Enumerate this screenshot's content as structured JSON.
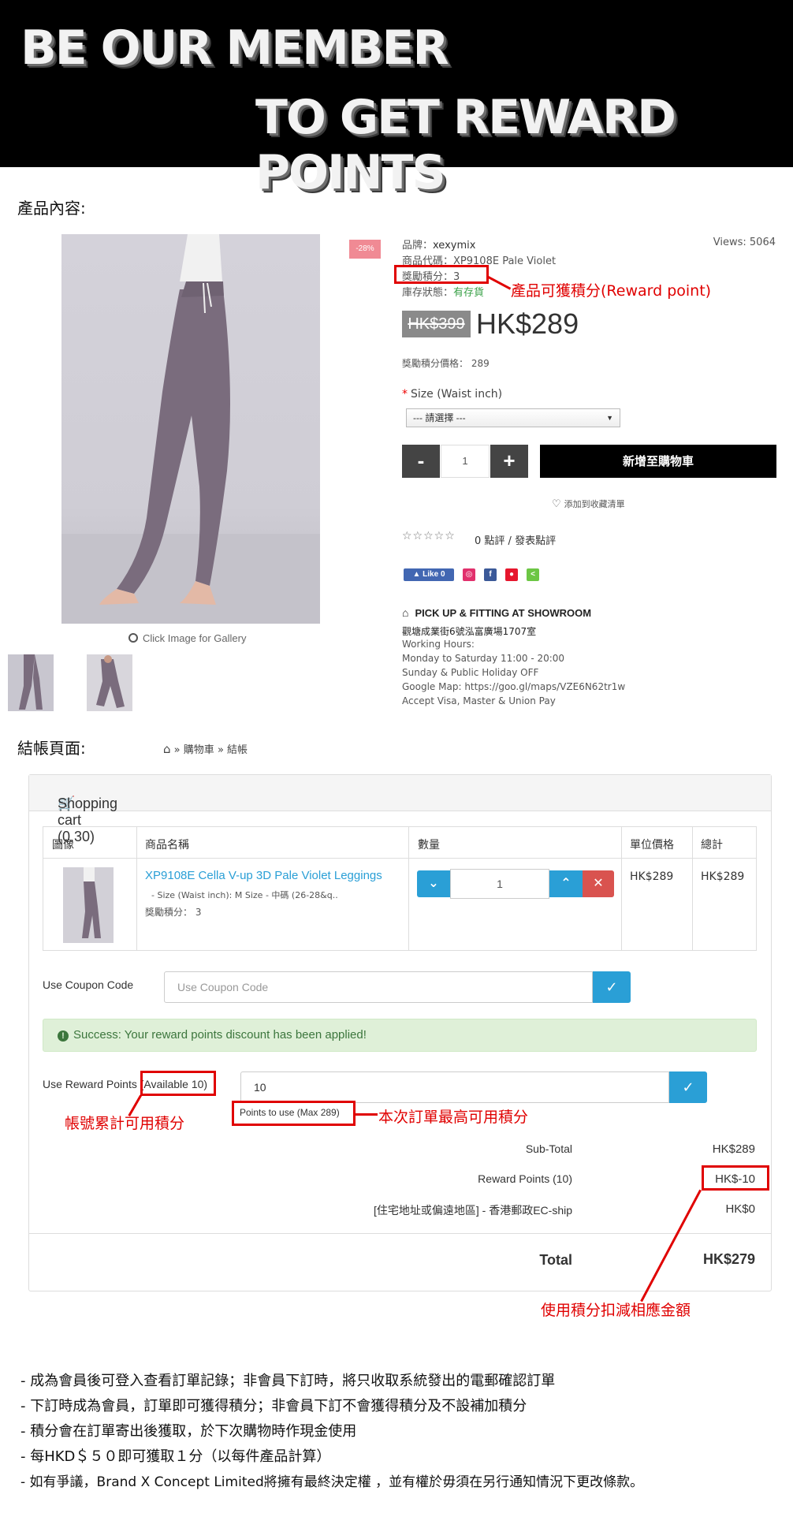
{
  "banner": {
    "line1": "BE OUR MEMBER",
    "line2": "TO GET REWARD POINTS"
  },
  "sections": {
    "product": "產品內容:",
    "checkout": "結帳頁面:"
  },
  "product": {
    "gallery_hint": "Click Image for Gallery",
    "discount_badge": "-28%",
    "brand_label": "品牌：",
    "brand_value": "xexymix",
    "code_label": "商品代碼：",
    "code_value": "XP9108E Pale Violet",
    "reward_label": "獎勵積分：",
    "reward_value": "3",
    "stock_label": "庫存狀態：",
    "stock_value": "有存貨",
    "views": "Views: 5064",
    "old_price": "HK$399",
    "price": "HK$289",
    "reward_price": "獎勵積分價格： 289",
    "size_label": "Size (Waist inch)",
    "size_placeholder": "--- 請選擇 ---",
    "qty_minus": "-",
    "qty_value": "1",
    "qty_plus": "+",
    "add_to_cart": "新增至購物車",
    "wishlist": "添加到收藏清單",
    "review_count": "0 點評",
    "write_review": "發表點評",
    "social": {
      "like": "Like 0"
    },
    "showroom": {
      "title": "PICK UP & FITTING AT SHOWROOM",
      "address": "觀塘成業街6號泓富廣場1707室",
      "hours_label": "Working Hours:",
      "weekday": "Monday to Saturday 11:00 - 20:00",
      "holiday": "Sunday & Public Holiday OFF",
      "map": "Google Map: https://goo.gl/maps/VZE6N62tr1w",
      "payment": "Accept Visa, Master & Union Pay"
    }
  },
  "annotations": {
    "reward_point": "產品可獲積分(Reward point)",
    "available": "帳號累計可用積分",
    "max_use": "本次訂單最高可用積分",
    "deduct": "使用積分扣減相應金額"
  },
  "breadcrumb": {
    "sep": "»",
    "cart": "購物車",
    "checkout": "結帳"
  },
  "cart": {
    "title": "Shopping cart (0.30)",
    "headers": [
      "圖像",
      "商品名稱",
      "數量",
      "單位價格",
      "總計"
    ],
    "item": {
      "name": "XP9108E Cella V-up 3D Pale Violet Leggings",
      "option": "- Size (Waist inch): M Size - 中碼 (26-28&q..",
      "reward": "獎勵積分： 3",
      "qty": "1",
      "unit_price": "HK$289",
      "total": "HK$289"
    },
    "coupon_label": "Use Coupon Code",
    "coupon_placeholder": "Use Coupon Code",
    "success_msg": "Success: Your reward points discount has been applied!",
    "reward_label": "Use Reward Points ",
    "reward_available": "(Available 10)",
    "reward_value": "10",
    "points_help": "Points to use (Max 289)",
    "totals": [
      {
        "label": "Sub-Total",
        "value": "HK$289"
      },
      {
        "label": "Reward Points (10)",
        "value": "HK$-10"
      },
      {
        "label": "[住宅地址或偏遠地區] - 香港郵政EC-ship",
        "value": "HK$0"
      }
    ],
    "grand_label": "Total",
    "grand_value": "HK$279"
  },
  "notes": [
    "- 成為會員後可登入查看訂單記錄；非會員下訂時，將只收取系統發出的電郵確認訂單",
    "- 下訂時成為會員，訂單即可獲得積分；非會員下訂不會獲得積分及不設補加積分",
    "- 積分會在訂單寄出後獲取，於下次購物時作現金使用",
    "- 每HKD＄５０即可獲取１分（以每件產品計算）",
    "- 如有爭議，Brand X Concept Limited將擁有最終決定權 ，並有權於毋須在另行通知情況下更改條款。"
  ],
  "colors": {
    "accent": "#2a9fd6",
    "annotation": "#e00000",
    "success_bg": "#dff0d8"
  }
}
